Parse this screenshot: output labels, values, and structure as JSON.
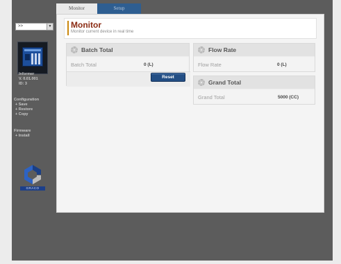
{
  "tabs": [
    {
      "label": "Monitor"
    },
    {
      "label": "Setup"
    }
  ],
  "sidebar": {
    "device_selector": ">>",
    "info_lines": [
      "Informer",
      "V. 0.01.001",
      "ID: 3"
    ],
    "configuration": {
      "title": "Configuration",
      "links": [
        "+ Save",
        "+ Restore",
        "+ Copy"
      ]
    },
    "firmware": {
      "title": "Firmware",
      "links": [
        "+ Install"
      ]
    },
    "logo_text": "GRACO"
  },
  "header": {
    "title": "Monitor",
    "subtitle": "Monitor current device in real time"
  },
  "batch_total": {
    "title": "Batch Total",
    "field_label": "Batch Total",
    "value": "0 (L)",
    "reset_label": "Reset"
  },
  "flow_rate": {
    "title": "Flow Rate",
    "field_label": "Flow Rate",
    "value": "0 (L)"
  },
  "grand_total": {
    "title": "Grand Total",
    "field_label": "Grand Total",
    "value": "5000 (CC)"
  },
  "colors": {
    "title": "#8a2a12",
    "accent": "#c9860a",
    "button": "#234e84",
    "tab_inactive": "#2e5e91"
  }
}
